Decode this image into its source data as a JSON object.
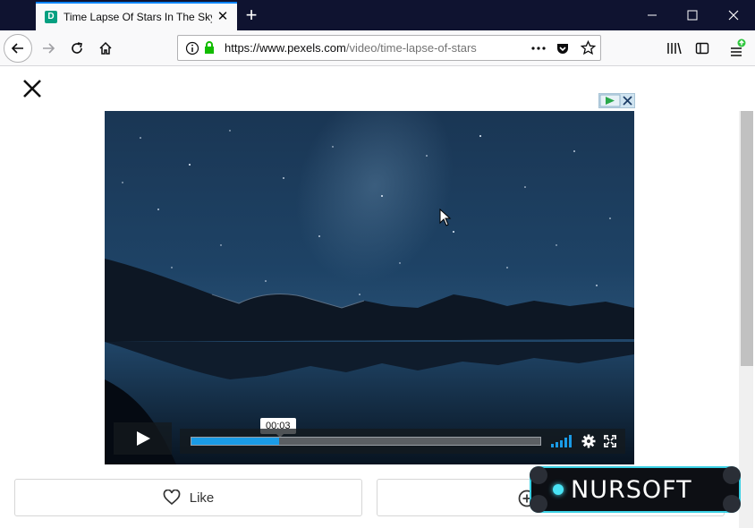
{
  "browser": {
    "tab": {
      "favicon_letter": "D",
      "title": "Time Lapse Of Stars In The Sky"
    },
    "url": {
      "host": "https://www.pexels.com",
      "path": "/video/time-lapse-of-stars"
    }
  },
  "player": {
    "time_tooltip": "00:03",
    "progress": 0.25
  },
  "actions": {
    "like_label": "Like"
  },
  "watermark": {
    "text": "NURSOFT"
  },
  "colors": {
    "titlebar": "#0f1330",
    "accent": "#0a84ff",
    "progress": "#1a9be6",
    "watermark_border": "#39d0e4"
  }
}
